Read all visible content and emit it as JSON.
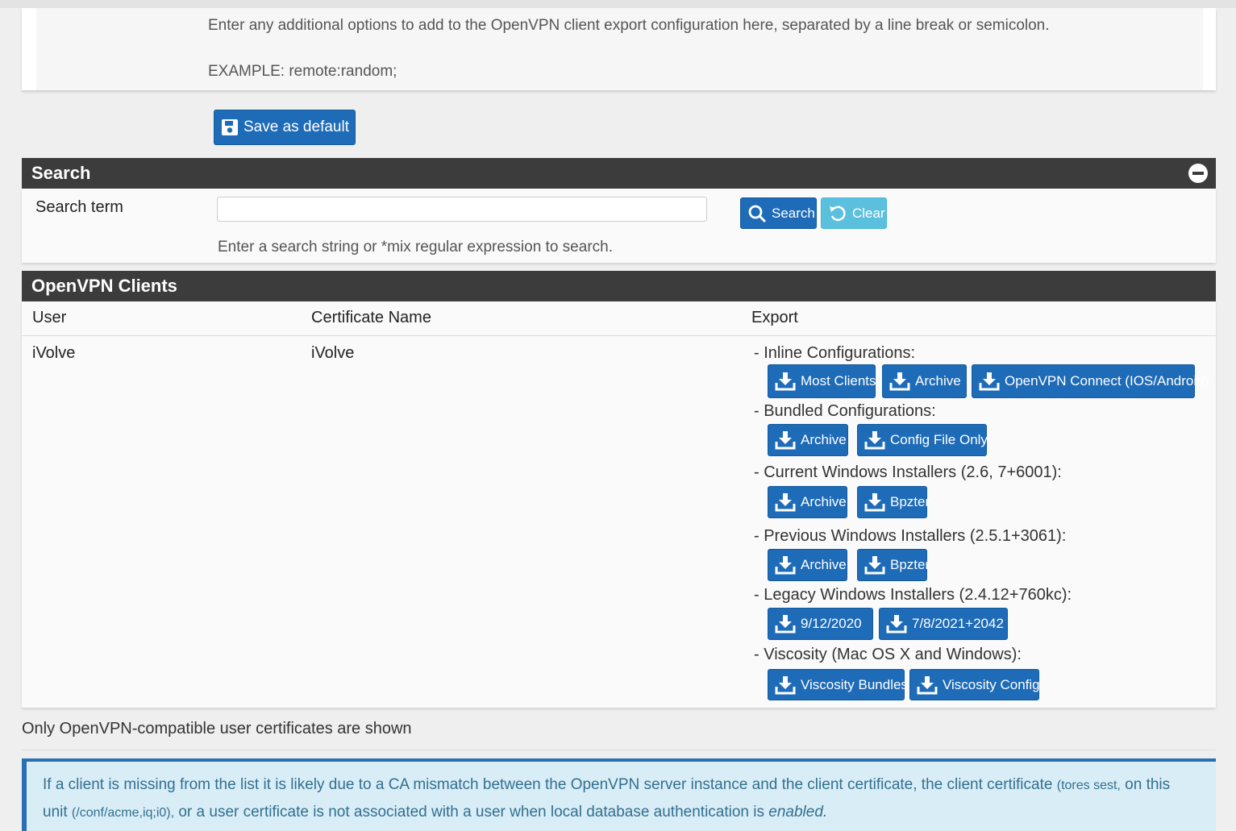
{
  "advanced": {
    "help_line1": "Enter any additional options to add to the OpenVPN client export configuration here, separated by a line break or semicolon.",
    "help_line2": "EXAMPLE: remote:random;"
  },
  "save_default_label": "Save as default",
  "search_section": {
    "title": "Search",
    "term_label": "Search term",
    "input_value": "",
    "input_placeholder": "",
    "search_button": "Search",
    "clear_button": "Clear",
    "help": "Enter a search string or *mix regular expression to search."
  },
  "clients_section": {
    "title": "OpenVPN Clients",
    "columns": [
      "User",
      "Certificate Name",
      "Export"
    ],
    "row": {
      "user": "iVolve",
      "certificate": "iVolve",
      "groups": [
        {
          "label": "- Inline Configurations:",
          "buttons": [
            "Most Clients",
            "Archive",
            "OpenVPN Connect (IOS/Android)"
          ]
        },
        {
          "label": "- Bundled Configurations:",
          "buttons": [
            "Archive",
            "Config File Only"
          ]
        },
        {
          "label": "- Current Windows Installers (2.6, 7+6001):",
          "buttons": [
            "Archive",
            "Bpzter"
          ]
        },
        {
          "label": "- Previous Windows Installers (2.5.1+3061):",
          "buttons": [
            "Archive",
            "Bpzter"
          ]
        },
        {
          "label": "- Legacy Windows Installers (2.4.12+760kc):",
          "buttons": [
            "9/12/2020",
            "7/8/2021+2042"
          ]
        },
        {
          "label": "- Viscosity (Mac OS X and Windows):",
          "buttons": [
            "Viscosity Bundles",
            "Viscosity Config"
          ]
        }
      ]
    }
  },
  "footnote": "Only OpenVPN-compatible user certificates are shown",
  "alert": {
    "text1": "If a client is missing from the list it is likely due to a CA mismatch between the OpenVPN server instance and the client certificate, the client certificate",
    "small1": "(tores sest,",
    "text2": "on this",
    "text3": "unit",
    "small2": "(/conf/acme,iq;i0),",
    "text4": "or a user certificate is not associated with a user when local database authentication is",
    "emph": "enabled."
  },
  "colors": {
    "primary": "#1e6bb8",
    "info": "#5bc0de",
    "header": "#3c3c3c",
    "alert_bg": "#d9edf7"
  }
}
